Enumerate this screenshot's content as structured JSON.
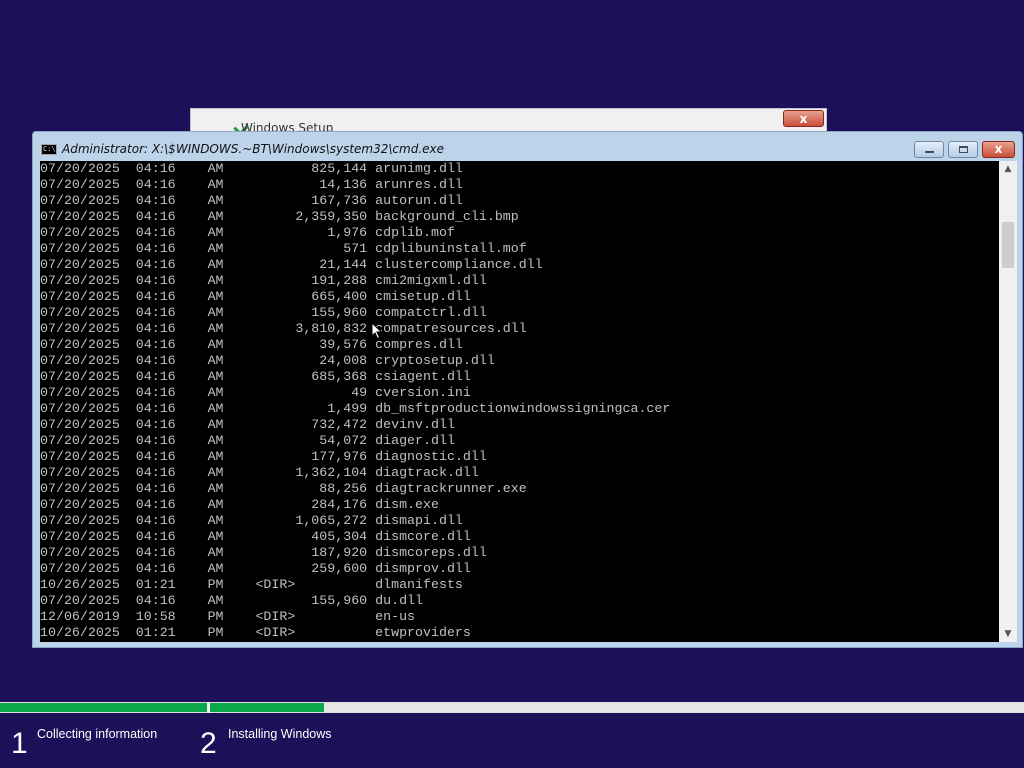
{
  "background_color": "#1e1058",
  "setup_window": {
    "title": "Windows Setup",
    "close_label": "x"
  },
  "cmd_window": {
    "title": "Administrator: X:\\$WINDOWS.~BT\\Windows\\system32\\cmd.exe",
    "icon_text": "C:\\",
    "close_label": "x"
  },
  "console_lines": [
    {
      "date": "07/20/2025",
      "time": "04:16",
      "ampm": "AM",
      "size": "825,144",
      "dir": "",
      "name": "arunimg.dll"
    },
    {
      "date": "07/20/2025",
      "time": "04:16",
      "ampm": "AM",
      "size": "14,136",
      "dir": "",
      "name": "arunres.dll"
    },
    {
      "date": "07/20/2025",
      "time": "04:16",
      "ampm": "AM",
      "size": "167,736",
      "dir": "",
      "name": "autorun.dll"
    },
    {
      "date": "07/20/2025",
      "time": "04:16",
      "ampm": "AM",
      "size": "2,359,350",
      "dir": "",
      "name": "background_cli.bmp"
    },
    {
      "date": "07/20/2025",
      "time": "04:16",
      "ampm": "AM",
      "size": "1,976",
      "dir": "",
      "name": "cdplib.mof"
    },
    {
      "date": "07/20/2025",
      "time": "04:16",
      "ampm": "AM",
      "size": "571",
      "dir": "",
      "name": "cdplibuninstall.mof"
    },
    {
      "date": "07/20/2025",
      "time": "04:16",
      "ampm": "AM",
      "size": "21,144",
      "dir": "",
      "name": "clustercompliance.dll"
    },
    {
      "date": "07/20/2025",
      "time": "04:16",
      "ampm": "AM",
      "size": "191,288",
      "dir": "",
      "name": "cmi2migxml.dll"
    },
    {
      "date": "07/20/2025",
      "time": "04:16",
      "ampm": "AM",
      "size": "665,400",
      "dir": "",
      "name": "cmisetup.dll"
    },
    {
      "date": "07/20/2025",
      "time": "04:16",
      "ampm": "AM",
      "size": "155,960",
      "dir": "",
      "name": "compatctrl.dll"
    },
    {
      "date": "07/20/2025",
      "time": "04:16",
      "ampm": "AM",
      "size": "3,810,832",
      "dir": "",
      "name": "compatresources.dll"
    },
    {
      "date": "07/20/2025",
      "time": "04:16",
      "ampm": "AM",
      "size": "39,576",
      "dir": "",
      "name": "compres.dll"
    },
    {
      "date": "07/20/2025",
      "time": "04:16",
      "ampm": "AM",
      "size": "24,008",
      "dir": "",
      "name": "cryptosetup.dll"
    },
    {
      "date": "07/20/2025",
      "time": "04:16",
      "ampm": "AM",
      "size": "685,368",
      "dir": "",
      "name": "csiagent.dll"
    },
    {
      "date": "07/20/2025",
      "time": "04:16",
      "ampm": "AM",
      "size": "49",
      "dir": "",
      "name": "cversion.ini"
    },
    {
      "date": "07/20/2025",
      "time": "04:16",
      "ampm": "AM",
      "size": "1,499",
      "dir": "",
      "name": "db_msftproductionwindowssigningca.cer"
    },
    {
      "date": "07/20/2025",
      "time": "04:16",
      "ampm": "AM",
      "size": "732,472",
      "dir": "",
      "name": "devinv.dll"
    },
    {
      "date": "07/20/2025",
      "time": "04:16",
      "ampm": "AM",
      "size": "54,072",
      "dir": "",
      "name": "diager.dll"
    },
    {
      "date": "07/20/2025",
      "time": "04:16",
      "ampm": "AM",
      "size": "177,976",
      "dir": "",
      "name": "diagnostic.dll"
    },
    {
      "date": "07/20/2025",
      "time": "04:16",
      "ampm": "AM",
      "size": "1,362,104",
      "dir": "",
      "name": "diagtrack.dll"
    },
    {
      "date": "07/20/2025",
      "time": "04:16",
      "ampm": "AM",
      "size": "88,256",
      "dir": "",
      "name": "diagtrackrunner.exe"
    },
    {
      "date": "07/20/2025",
      "time": "04:16",
      "ampm": "AM",
      "size": "284,176",
      "dir": "",
      "name": "dism.exe"
    },
    {
      "date": "07/20/2025",
      "time": "04:16",
      "ampm": "AM",
      "size": "1,065,272",
      "dir": "",
      "name": "dismapi.dll"
    },
    {
      "date": "07/20/2025",
      "time": "04:16",
      "ampm": "AM",
      "size": "405,304",
      "dir": "",
      "name": "dismcore.dll"
    },
    {
      "date": "07/20/2025",
      "time": "04:16",
      "ampm": "AM",
      "size": "187,920",
      "dir": "",
      "name": "dismcoreps.dll"
    },
    {
      "date": "07/20/2025",
      "time": "04:16",
      "ampm": "AM",
      "size": "259,600",
      "dir": "",
      "name": "dismprov.dll"
    },
    {
      "date": "10/26/2025",
      "time": "01:21",
      "ampm": "PM",
      "size": "",
      "dir": "<DIR>",
      "name": "dlmanifests"
    },
    {
      "date": "07/20/2025",
      "time": "04:16",
      "ampm": "AM",
      "size": "155,960",
      "dir": "",
      "name": "du.dll"
    },
    {
      "date": "12/06/2019",
      "time": "10:58",
      "ampm": "PM",
      "size": "",
      "dir": "<DIR>",
      "name": "en-us"
    },
    {
      "date": "10/26/2025",
      "time": "01:21",
      "ampm": "PM",
      "size": "",
      "dir": "<DIR>",
      "name": "etwproviders"
    }
  ],
  "progress": {
    "step1_fraction": 1.0,
    "step2_fraction": 0.14,
    "color": "#0aa84a"
  },
  "steps": [
    {
      "number": "1",
      "label": "Collecting information"
    },
    {
      "number": "2",
      "label": "Installing Windows"
    }
  ]
}
